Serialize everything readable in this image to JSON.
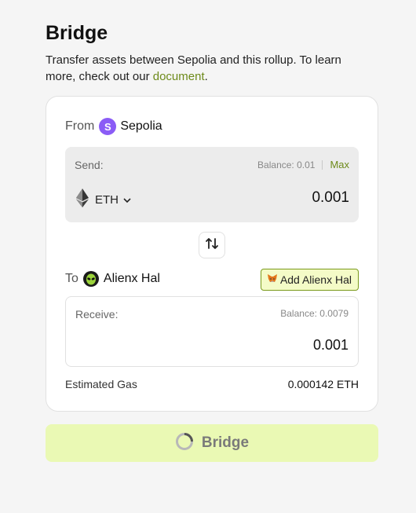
{
  "header": {
    "title": "Bridge",
    "description_prefix": "Transfer assets between Sepolia and this rollup. To learn more, check out our ",
    "link_text": "document",
    "description_suffix": "."
  },
  "from": {
    "label": "From",
    "chain_initial": "S",
    "chain_name": "Sepolia"
  },
  "send": {
    "label": "Send:",
    "balance": "Balance: 0.01",
    "max_label": "Max",
    "token": "ETH",
    "amount": "0.001"
  },
  "to": {
    "label": "To",
    "chain_name": "Alienx Hal",
    "add_button_label": "Add Alienx Hal"
  },
  "receive": {
    "label": "Receive:",
    "balance": "Balance: 0.0079",
    "amount": "0.001"
  },
  "gas": {
    "label": "Estimated Gas",
    "value": "0.000142 ETH"
  },
  "submit": {
    "label": "Bridge"
  },
  "colors": {
    "accent_green": "#6d8a1a",
    "button_bg": "#eaf9b4",
    "sepolia_purple": "#8b5cf6"
  }
}
